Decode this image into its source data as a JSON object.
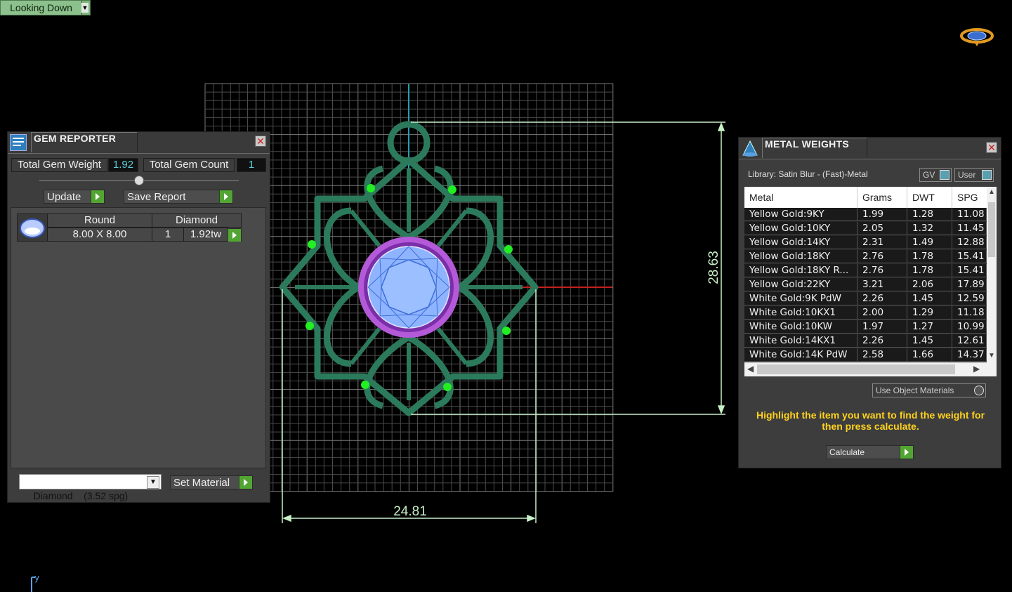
{
  "view_dropdown": {
    "label": "Looking Down"
  },
  "gem_reporter": {
    "title": "GEM REPORTER",
    "total_weight_label": "Total Gem Weight",
    "total_weight_value": "1.92",
    "total_count_label": "Total Gem Count",
    "total_count_value": "1",
    "update_label": "Update",
    "save_label": "Save Report",
    "gem_row": {
      "shape": "Round",
      "material": "Diamond",
      "size": "8.00 X 8.00",
      "count": "1",
      "weight": "1.92tw"
    },
    "material_select": "Diamond    (3.52 spg)",
    "set_material_label": "Set Material"
  },
  "metal_weights": {
    "title": "METAL WEIGHTS",
    "library": "Library: Satin Blur - (Fast)-Metal",
    "gv_label": "GV",
    "user_label": "User",
    "columns": [
      "Metal",
      "Grams",
      "DWT",
      "SPG"
    ],
    "rows": [
      [
        "Yellow Gold:9KY",
        "1.99",
        "1.28",
        "11.08"
      ],
      [
        "Yellow Gold:10KY",
        "2.05",
        "1.32",
        "11.45"
      ],
      [
        "Yellow Gold:14KY",
        "2.31",
        "1.49",
        "12.88"
      ],
      [
        "Yellow Gold:18KY",
        "2.76",
        "1.78",
        "15.41"
      ],
      [
        "Yellow Gold:18KY R...",
        "2.76",
        "1.78",
        "15.41"
      ],
      [
        "Yellow Gold:22KY",
        "3.21",
        "2.06",
        "17.89"
      ],
      [
        "White Gold:9K PdW",
        "2.26",
        "1.45",
        "12.59"
      ],
      [
        "White Gold:10KX1",
        "2.00",
        "1.29",
        "11.18"
      ],
      [
        "White Gold:10KW",
        "1.97",
        "1.27",
        "10.99"
      ],
      [
        "White Gold:14KX1",
        "2.26",
        "1.45",
        "12.61"
      ],
      [
        "White Gold:14K PdW",
        "2.58",
        "1.66",
        "14.37"
      ]
    ],
    "use_object_materials": "Use Object Materials",
    "hint": "Highlight the item you want to find the weight for then press calculate.",
    "calculate_label": "Calculate"
  },
  "viewport": {
    "dim_height": "28.63",
    "dim_width": "24.81",
    "axis_label": "y"
  },
  "colors": {
    "metal": "#2c7a5c",
    "gem": "#8fb4ff",
    "bezel": "#9b3fc0",
    "prong": "#22ee22",
    "dimension": "#c8f0c8",
    "hint": "#ffd21e"
  }
}
